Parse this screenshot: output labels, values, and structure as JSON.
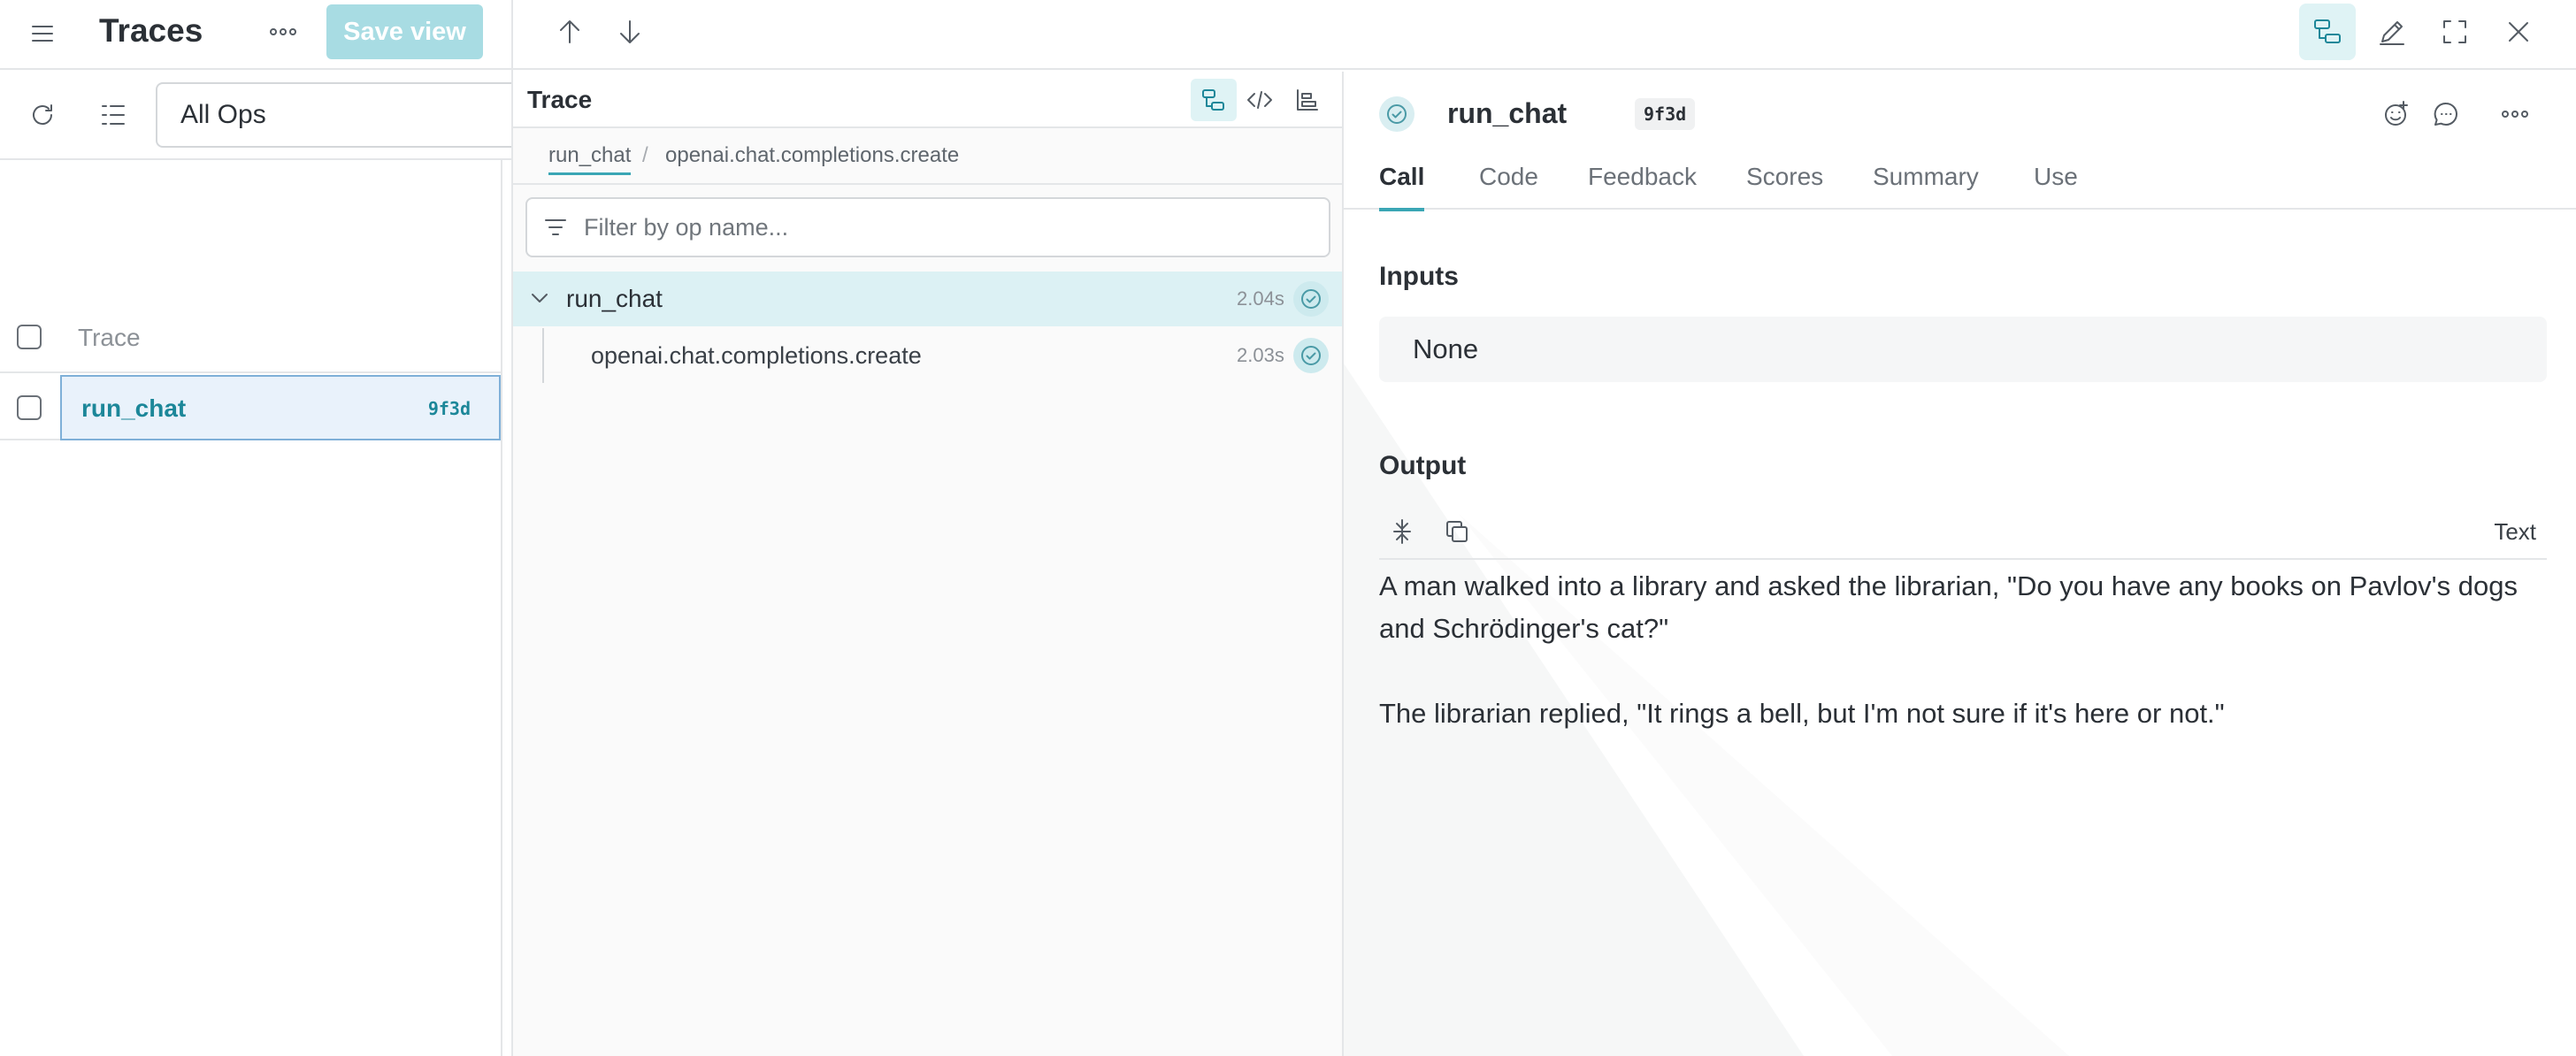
{
  "header": {
    "title": "Traces",
    "save_view_label": "Save view"
  },
  "filter": {
    "ops_selected": "All Ops"
  },
  "table": {
    "column_trace": "Trace",
    "rows": [
      {
        "name": "run_chat",
        "id": "9f3d"
      }
    ]
  },
  "trace_panel": {
    "title": "Trace",
    "breadcrumb": [
      "run_chat",
      "openai.chat.completions.create"
    ],
    "breadcrumb_separator": "/",
    "filter_placeholder": "Filter by op name...",
    "nodes": [
      {
        "name": "run_chat",
        "duration": "2.04s"
      },
      {
        "name": "openai.chat.completions.create",
        "duration": "2.03s"
      }
    ]
  },
  "call": {
    "name": "run_chat",
    "id": "9f3d",
    "tabs": [
      "Call",
      "Code",
      "Feedback",
      "Scores",
      "Summary",
      "Use"
    ],
    "active_tab": "Call",
    "inputs_label": "Inputs",
    "inputs_value": "None",
    "output_label": "Output",
    "output_format": "Text",
    "output_lines": [
      "A man walked into a library and asked the librarian, \"Do you have any books on Pavlov's dogs and Schrödinger's cat?\"",
      "The librarian replied, \"It rings a bell, but I'm not sure if it's here or not.\""
    ]
  },
  "icons": {
    "menu": "hamburger-icon",
    "more": "more-horizontal-icon",
    "refresh": "refresh-icon",
    "columns": "columns-icon",
    "nav_up": "arrow-up-icon",
    "nav_down": "arrow-down-icon",
    "tree_view": "tree-view-icon",
    "edit": "pencil-icon",
    "fullscreen": "fullscreen-icon",
    "close": "close-icon",
    "code": "code-icon",
    "flame": "flame-graph-icon",
    "filter": "filter-lines-icon",
    "status": "check-circle-icon",
    "reaction": "emoji-add-icon",
    "comment": "comment-icon",
    "collapse": "collapse-icon",
    "copy": "copy-icon"
  },
  "colors": {
    "accent": "#3aa6b5",
    "accent_text": "#1c8799",
    "save_view_bg": "#a8dce3",
    "selected_row_bg": "#e9f2fb",
    "tree_selected_bg": "#dcf1f4"
  }
}
